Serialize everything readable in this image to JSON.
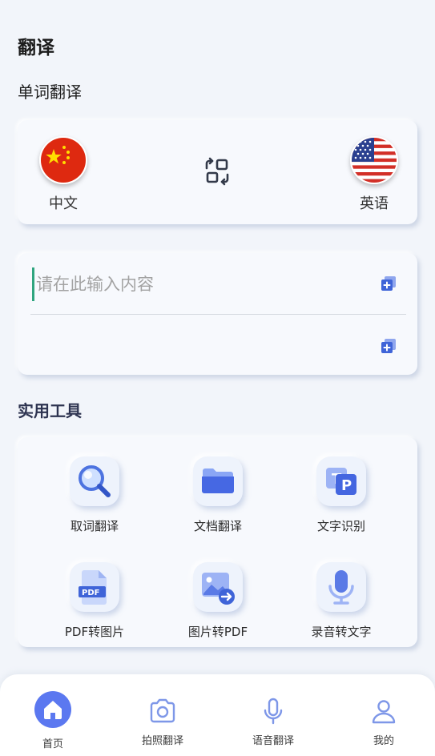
{
  "header": {
    "title": "翻译"
  },
  "word_translate": {
    "section_title": "单词翻译",
    "source_lang": {
      "label": "中文",
      "flag": "china-flag"
    },
    "target_lang": {
      "label": "英语",
      "flag": "usa-flag"
    },
    "swap_icon": "swap-icon"
  },
  "input": {
    "placeholder": "请在此输入内容",
    "value": ""
  },
  "tools": {
    "section_title": "实用工具",
    "items": [
      {
        "label": "取词翻译",
        "icon": "magnifier-icon"
      },
      {
        "label": "文档翻译",
        "icon": "folder-icon"
      },
      {
        "label": "文字识别",
        "icon": "text-recognition-icon"
      },
      {
        "label": "PDF转图片",
        "icon": "pdf-file-icon"
      },
      {
        "label": "图片转PDF",
        "icon": "image-convert-icon"
      },
      {
        "label": "录音转文字",
        "icon": "microphone-icon"
      }
    ]
  },
  "nav": {
    "items": [
      {
        "label": "首页",
        "icon": "home-icon",
        "active": true
      },
      {
        "label": "拍照翻译",
        "icon": "camera-icon",
        "active": false
      },
      {
        "label": "语音翻译",
        "icon": "microphone-icon",
        "active": false
      },
      {
        "label": "我的",
        "icon": "user-icon",
        "active": false
      }
    ]
  },
  "colors": {
    "accent": "#5b78f0",
    "icon_blue": "#3f64d8",
    "background": "#f2f5fa"
  }
}
